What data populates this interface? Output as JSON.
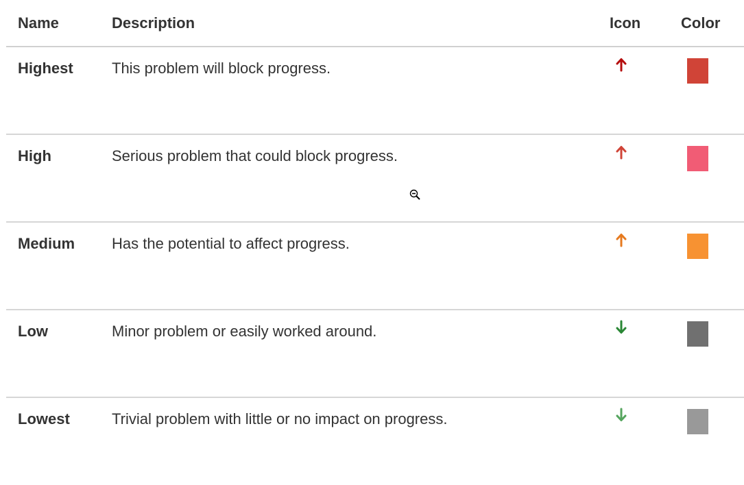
{
  "table": {
    "headers": {
      "name": "Name",
      "description": "Description",
      "icon": "Icon",
      "color": "Color"
    },
    "rows": [
      {
        "name": "Highest",
        "description": "This problem will block progress.",
        "icon": "arrow-up-icon",
        "icon_color": "#b50e0e",
        "color": "#d04437"
      },
      {
        "name": "High",
        "description": "Serious problem that could block progress.",
        "icon": "arrow-up-icon",
        "icon_color": "#d04437",
        "color": "#f15c75"
      },
      {
        "name": "Medium",
        "description": "Has the potential to affect progress.",
        "icon": "arrow-up-icon",
        "icon_color": "#e67a1f",
        "color": "#f79232"
      },
      {
        "name": "Low",
        "description": "Minor problem or easily worked around.",
        "icon": "arrow-down-icon",
        "icon_color": "#2a8735",
        "color": "#707070"
      },
      {
        "name": "Lowest",
        "description": "Trivial problem with little or no impact on progress.",
        "icon": "arrow-down-icon",
        "icon_color": "#55a55e",
        "color": "#999999"
      }
    ]
  },
  "cursor": "zoom-out-cursor-icon"
}
